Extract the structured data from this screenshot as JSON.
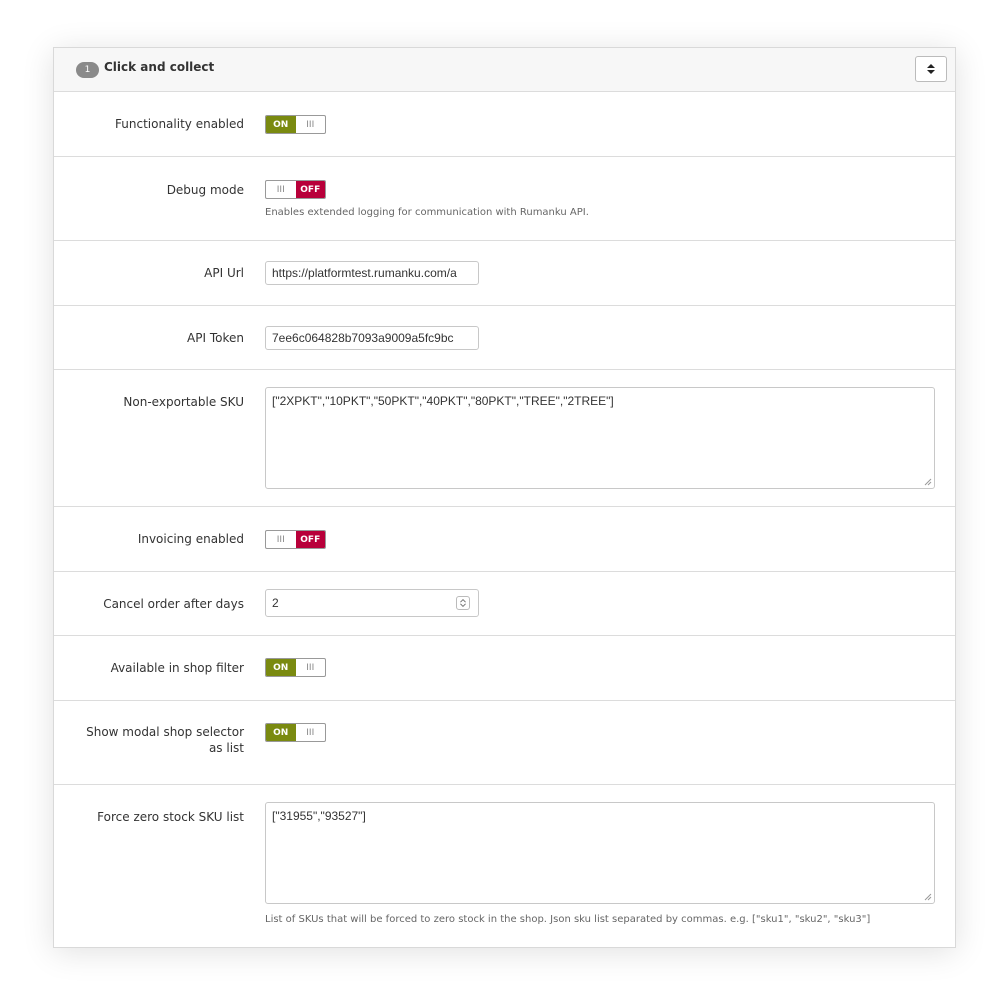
{
  "header": {
    "step": "1",
    "title": "Click and collect"
  },
  "toggle_text": {
    "on": "ON",
    "off": "OFF",
    "grip": "III"
  },
  "fields": {
    "functionality": {
      "label": "Functionality enabled",
      "state": "on"
    },
    "debug": {
      "label": "Debug mode",
      "state": "off",
      "help": "Enables extended logging for communication with Rumanku API."
    },
    "api_url": {
      "label": "API Url",
      "value": "https://platformtest.rumanku.com/a"
    },
    "api_token": {
      "label": "API Token",
      "value": "7ee6c064828b7093a9009a5fc9bc"
    },
    "non_exportable": {
      "label": "Non-exportable SKU",
      "value": "[\"2XPKT\",\"10PKT\",\"50PKT\",\"40PKT\",\"80PKT\",\"TREE\",\"2TREE\"]"
    },
    "invoicing": {
      "label": "Invoicing enabled",
      "state": "off"
    },
    "cancel_days": {
      "label": "Cancel order after days",
      "value": "2"
    },
    "shop_filter": {
      "label": "Available in shop filter",
      "state": "on"
    },
    "modal_selector": {
      "label_line1": "Show modal shop selector",
      "label_line2": "as list",
      "state": "on"
    },
    "force_zero": {
      "label": "Force zero stock SKU list",
      "value": "[\"31955\",\"93527\"]",
      "help": "List of SKUs that will be forced to zero stock in the shop. Json sku list separated by commas. e.g. [\"sku1\", \"sku2\", \"sku3\"]"
    }
  },
  "colors": {
    "on": "#7a8a10",
    "off": "#b8003a",
    "badge": "#8a8a8a"
  }
}
